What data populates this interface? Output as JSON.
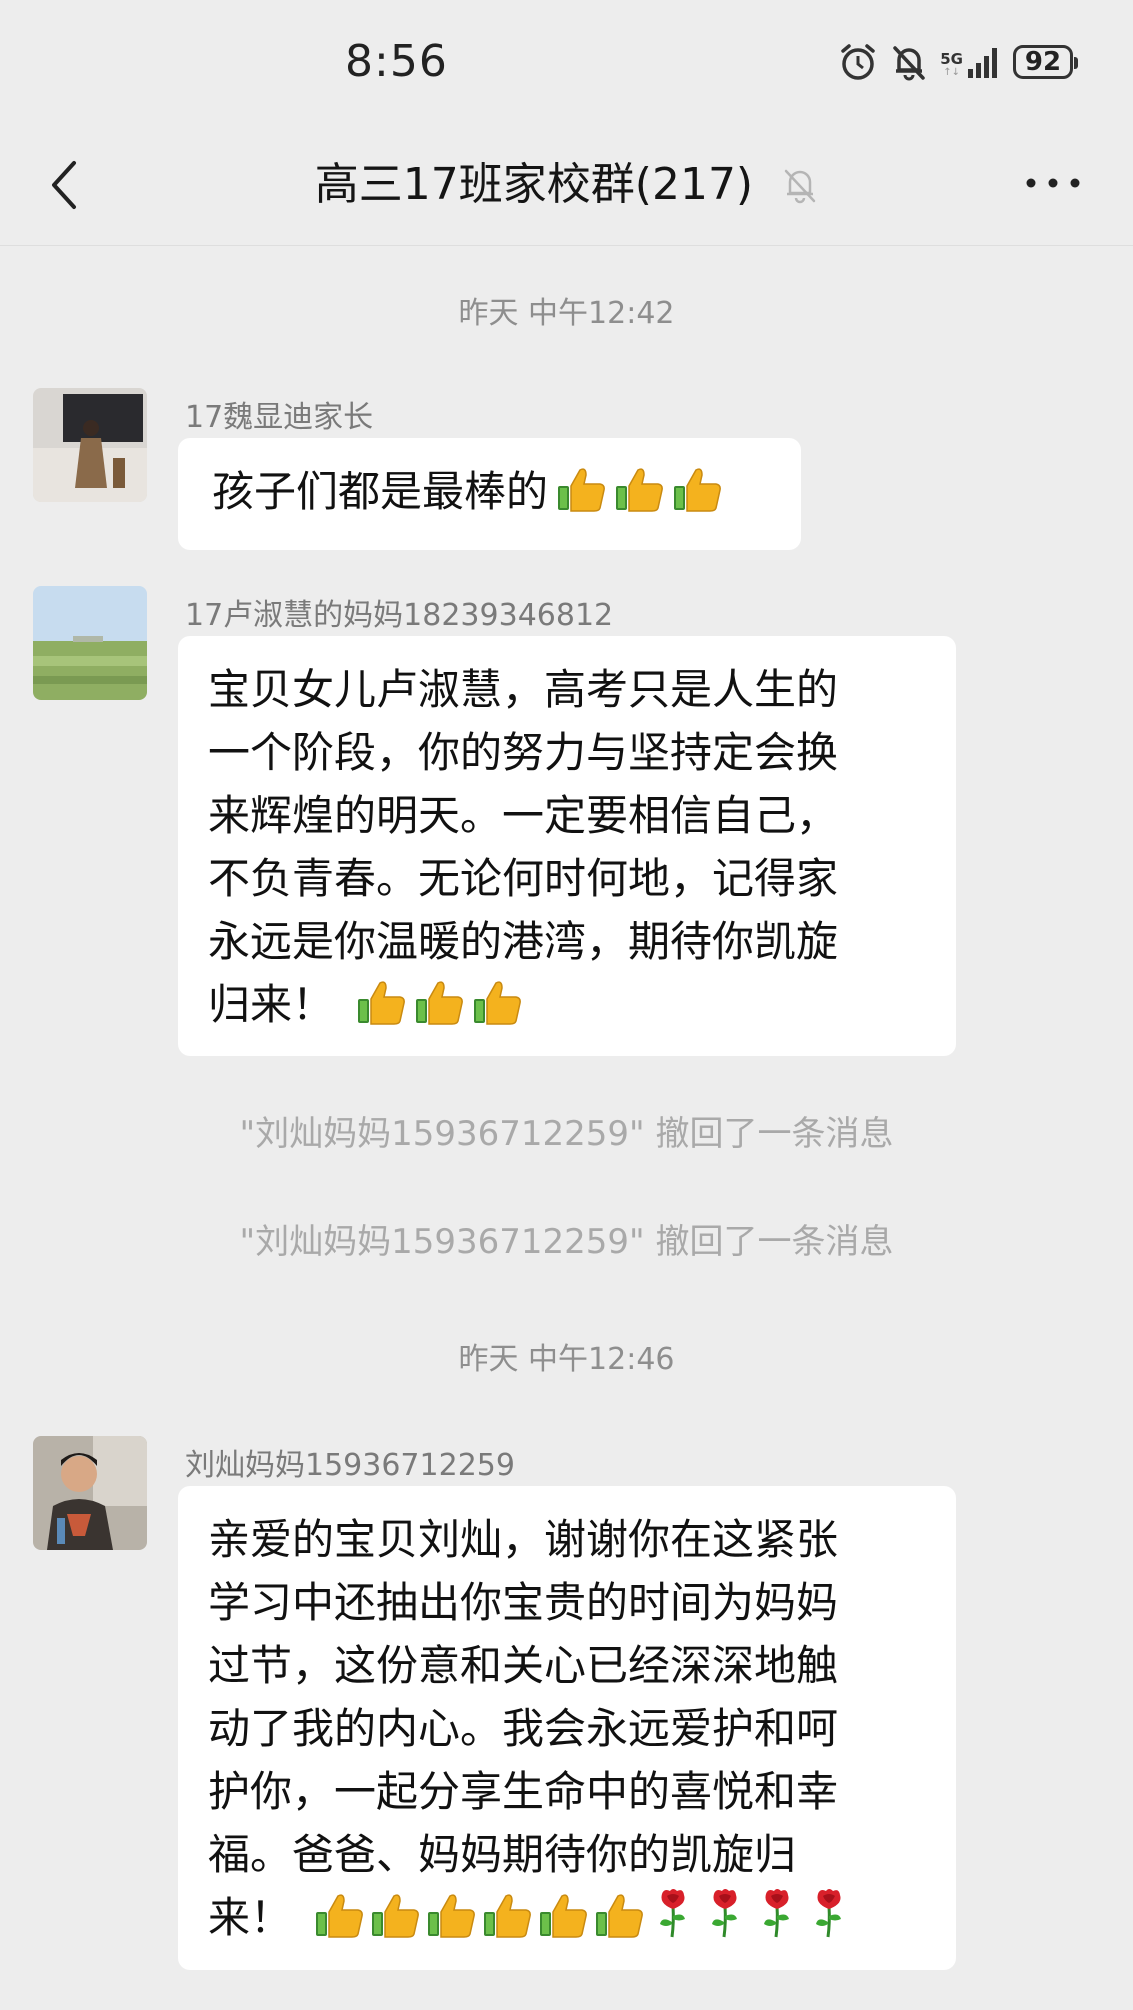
{
  "status_bar": {
    "time": "8:56",
    "network": "5G",
    "battery": "92",
    "icons": [
      "alarm-icon",
      "bell-off-icon",
      "signal-icon",
      "battery-icon"
    ]
  },
  "header": {
    "title": "高三17班家校群(217)",
    "icons": [
      "back-arrow-icon",
      "mute-bell-icon",
      "more-icon"
    ]
  },
  "messages": [
    {
      "type": "time",
      "text": "昨天 中午12:42"
    },
    {
      "type": "chat",
      "sender": "17魏显迪家长",
      "lines": [
        "孩子们都是最棒的"
      ],
      "emoji": [
        "thumbs-up",
        "thumbs-up",
        "thumbs-up"
      ]
    },
    {
      "type": "chat",
      "sender": "17卢淑慧的妈妈18239346812",
      "lines": [
        "宝贝女儿卢淑慧，高考只是人生的",
        "一个阶段，你的努力与坚持定会换",
        "来辉煌的明天。一定要相信自己，",
        "不负青春。无论何时何地，记得家",
        "永远是你温暖的港湾，期待你凯旋",
        "归来！"
      ],
      "emoji": [
        "thumbs-up",
        "thumbs-up",
        "thumbs-up"
      ]
    },
    {
      "type": "recall",
      "text": "\"刘灿妈妈15936712259\" 撤回了一条消息"
    },
    {
      "type": "recall",
      "text": "\"刘灿妈妈15936712259\" 撤回了一条消息"
    },
    {
      "type": "time",
      "text": "昨天 中午12:46"
    },
    {
      "type": "chat",
      "sender": "刘灿妈妈15936712259",
      "lines": [
        "亲爱的宝贝刘灿，谢谢你在这紧张",
        "学习中还抽出你宝贵的时间为妈妈",
        "过节，这份意和关心已经深深地触",
        "动了我的内心。我会永远爱护和呵",
        "护你，一起分享生命中的喜悦和幸",
        "福。爸爸、妈妈期待你的凯旋归",
        "来！"
      ],
      "emoji": [
        "thumbs-up",
        "thumbs-up",
        "thumbs-up",
        "thumbs-up",
        "thumbs-up",
        "thumbs-up",
        "rose",
        "rose",
        "rose",
        "rose"
      ]
    }
  ]
}
